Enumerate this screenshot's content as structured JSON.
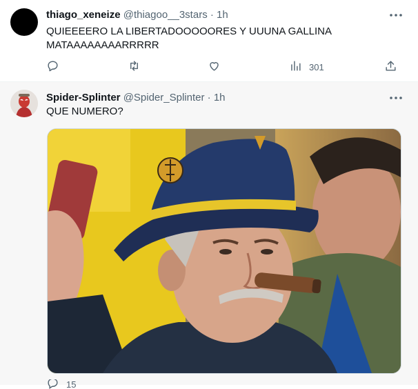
{
  "tweets": [
    {
      "display_name": "thiago_xeneize",
      "handle": "@thiagoo__3stars",
      "dot": "·",
      "time": "1h",
      "text_line1": "QUIEEEERO LA LIBERTADOOOOORES Y UUUNA GALLINA",
      "text_line2": "MATAAAAAAAARRRRR",
      "actions": {
        "reply": "",
        "retweet": "",
        "like": "",
        "views": "301",
        "share": ""
      }
    },
    {
      "display_name": "Spider-Splinter",
      "handle": "@Spider_Splinter",
      "dot": "·",
      "time": "1h",
      "text": "QUE NUMERO?",
      "actions": {
        "reply": "15"
      }
    }
  ],
  "icons": [
    "more-icon",
    "reply-icon",
    "retweet-icon",
    "like-icon",
    "views-icon",
    "share-icon"
  ],
  "colors": {
    "text": "#0f1419",
    "secondary": "#536471",
    "border": "#eff3f4"
  }
}
